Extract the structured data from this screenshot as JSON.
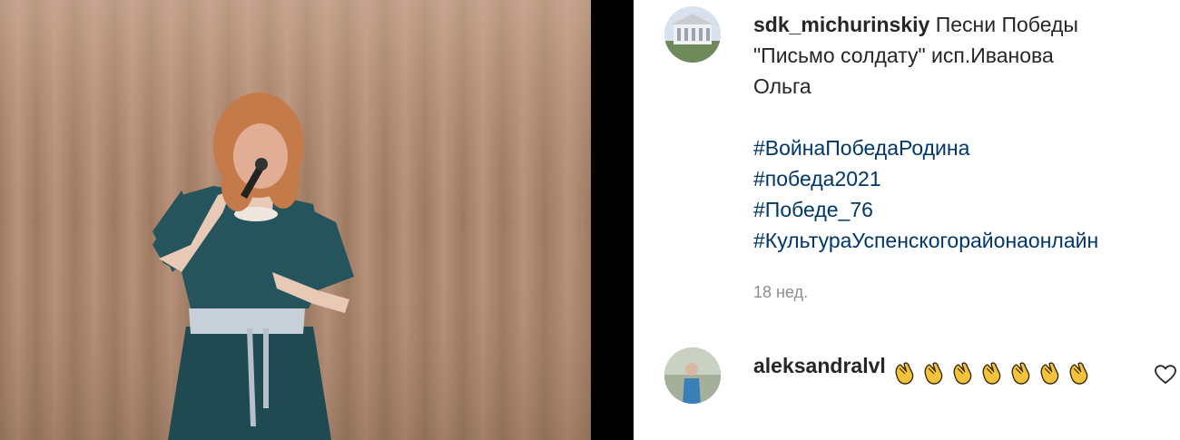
{
  "post": {
    "username": "sdk_michurinskiy",
    "caption_line1": "Песни Победы",
    "caption_line2": "\"Письмо солдату\" исп.Иванова",
    "caption_line3": "Ольга",
    "hashtags": [
      "#ВойнаПобедаРодина",
      "#победа2021",
      "#Победе_76",
      "#КультураУспенскогорайонаонлайн"
    ],
    "timestamp": "18 нед."
  },
  "comment": {
    "username": "aleksandralvl",
    "emoji": "clapping-hands",
    "emoji_count": 7
  },
  "colors": {
    "hashtag": "#00376b",
    "muted": "#8e8e8e",
    "text": "#262626"
  }
}
